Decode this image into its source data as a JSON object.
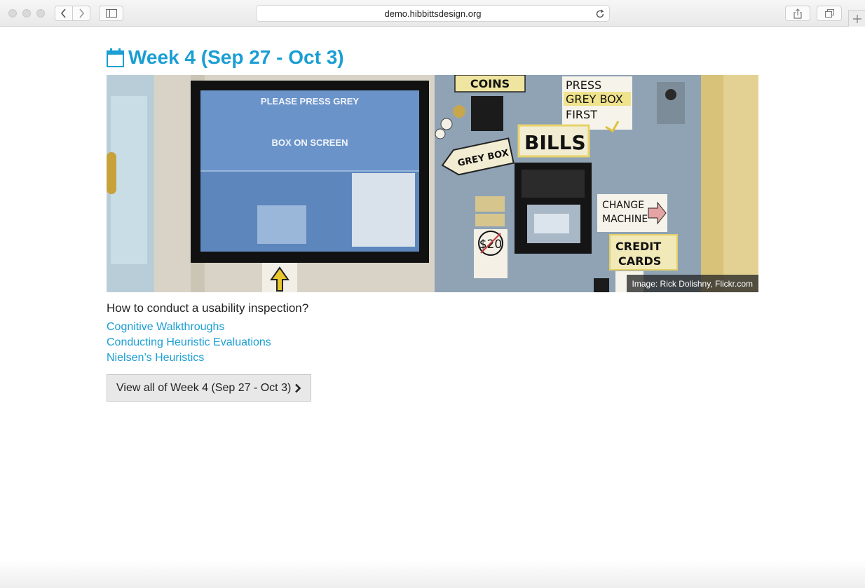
{
  "browser": {
    "url": "demo.hibbittsdesign.org",
    "icons": [
      "close-dot",
      "minimize-dot",
      "zoom-dot",
      "back-icon",
      "forward-icon",
      "sidebar-icon",
      "reload-icon",
      "share-icon",
      "tabs-icon",
      "plus-icon"
    ]
  },
  "page": {
    "title": "Week 4 (Sep 27 - Oct 3)",
    "title_icon": "calendar-icon",
    "image_alt": "Ticket machine with handwritten signs",
    "image_credit": "Image: Rick Dolishny, Flickr.com",
    "question": "How to conduct a usability inspection?",
    "links": [
      "Cognitive Walkthroughs",
      "Conducting Heuristic Evaluations",
      "Nielsen’s Heuristics"
    ],
    "view_all_label": "View all of Week 4 (Sep 27 - Oct 3)",
    "view_all_icon": "chevron-right-icon"
  },
  "photo_signs": {
    "screen_line1": "PLEASE PRESS GREY",
    "screen_line2": "BOX ON SCREEN",
    "coins": "COINS",
    "press": "PRESS",
    "grey_box": "GREY BOX",
    "first": "FIRST",
    "bills": "BILLS",
    "grey_box_arrow": "GREY BOX",
    "change": "CHANGE",
    "machine": "MACHINE",
    "credit": "CREDIT",
    "cards": "CARDS",
    "twenty": "$20"
  },
  "colors": {
    "accent": "#1a9ed4",
    "button_bg": "#e8e8e8",
    "text": "#222222"
  }
}
